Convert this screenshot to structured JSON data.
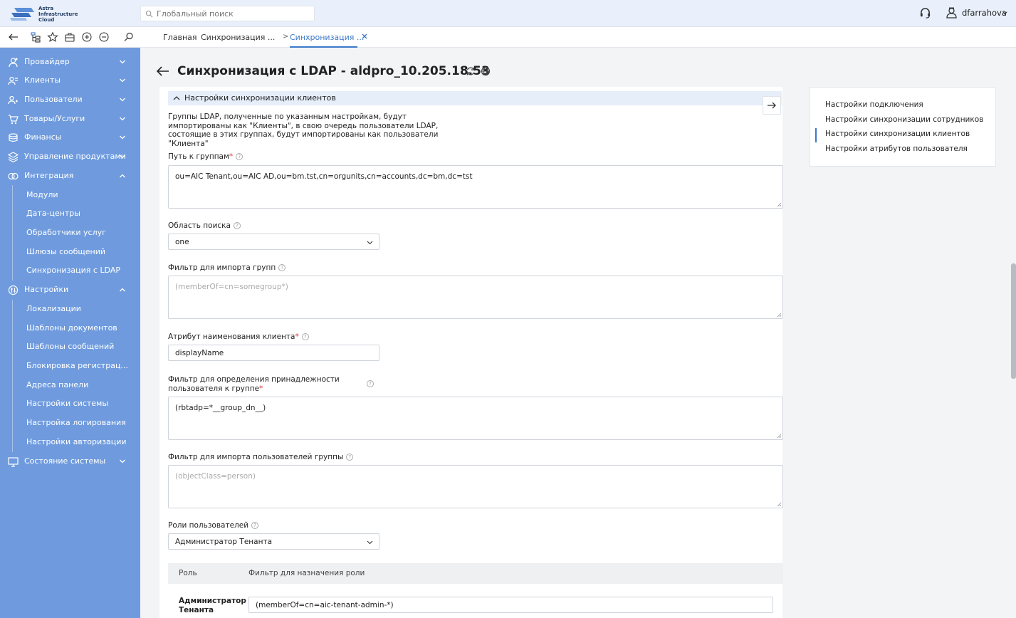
{
  "app": {
    "logo_lines": [
      "Astra",
      "Infrastructure",
      "Cloud"
    ],
    "search_placeholder": "Глобальный поиск",
    "user_name": "dfarrahova"
  },
  "tabs": {
    "home": "Главная",
    "tab2": "Синхронизация ...",
    "separator": ">",
    "active": "Синхронизация ..."
  },
  "sidebar": {
    "items": [
      {
        "label": "Провайдер",
        "icon": "provider-icon",
        "expanded": false
      },
      {
        "label": "Клиенты",
        "icon": "clients-icon",
        "expanded": false
      },
      {
        "label": "Пользователи",
        "icon": "users-icon",
        "expanded": false
      },
      {
        "label": "Товары/Услуги",
        "icon": "products-icon",
        "expanded": false
      },
      {
        "label": "Финансы",
        "icon": "finance-icon",
        "expanded": false
      },
      {
        "label": "Управление продуктами",
        "icon": "product-management-icon",
        "expanded": false
      },
      {
        "label": "Интеграция",
        "icon": "integration-icon",
        "expanded": true
      },
      {
        "label": "Настройки",
        "icon": "settings-icon",
        "expanded": true
      },
      {
        "label": "Состояние системы",
        "icon": "system-state-icon",
        "expanded": false
      }
    ],
    "integration_sub": [
      "Модули",
      "Дата-центры",
      "Обработчики услуг",
      "Шлюзы сообщений",
      "Синхронизация с LDAP"
    ],
    "settings_sub": [
      "Локализации",
      "Шаблоны документов",
      "Шаблоны сообщений",
      "Блокировка регистрац...",
      "Адреса панели",
      "Настройки системы",
      "Настройка логирования",
      "Настройки авторизации"
    ]
  },
  "page": {
    "title": "Синхронизация с LDAP - aldpro_10.205.18.53",
    "section_title": "Настройки синхронизации клиентов",
    "description": "Группы LDAP, полученные по указанным настройкам, будут импортированы как \"Клиенты\", в свою очередь пользователи LDAP, состоящие в этих группах, будут импортированы как пользователи \"Клиента\"",
    "fields": {
      "group_path": {
        "label": "Путь к группам",
        "value": "ou=AIC Tenant,ou=AIC AD,ou=bm.tst,cn=orgunits,cn=accounts,dc=bm,dc=tst"
      },
      "search_scope": {
        "label": "Область поиска",
        "value": "one"
      },
      "group_filter": {
        "label": "Фильтр для импорта групп",
        "placeholder": "(memberOf=cn=somegroup*)"
      },
      "client_name_attr": {
        "label": "Атрибут наименования клиента",
        "value": "displayName"
      },
      "membership_filter": {
        "label_line1": "Фильтр для определения принадлежности",
        "label_line2": "пользователя к группе",
        "value": "(rbtadp=*__group_dn__)"
      },
      "user_filter": {
        "label": "Фильтр для импорта пользователей группы",
        "placeholder": "(objectClass=person)"
      },
      "user_roles": {
        "label": "Роли пользователей",
        "value": "Администратор Тенанта"
      }
    },
    "table": {
      "col_role": "Роль",
      "col_filter": "Фильтр для назначения роли",
      "rows": [
        {
          "role": "Администратор Тенанта",
          "filter": "(memberOf=cn=aic-tenant-admin-*)"
        }
      ]
    },
    "help_glyph": "?",
    "required_mark": "*"
  },
  "toc": {
    "items": [
      "Настройки подключения",
      "Настройки синхронизации сотрудников",
      "Настройки синхронизации клиентов",
      "Настройки атрибутов пользователя"
    ],
    "active_index": 2
  },
  "colors": {
    "sidebar_bg": "#6f9bde",
    "accent": "#3d78c8",
    "required": "#e0323a"
  }
}
